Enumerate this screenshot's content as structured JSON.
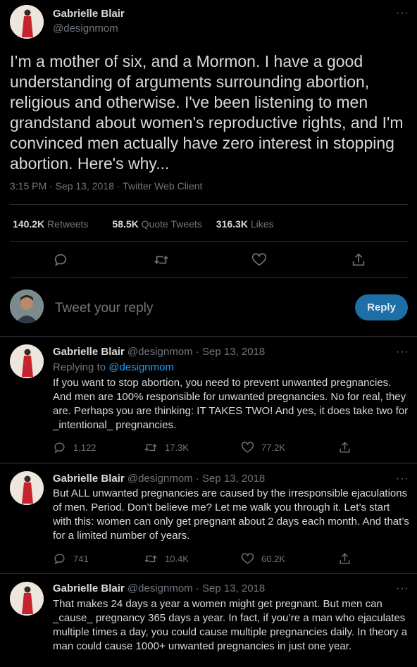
{
  "main": {
    "author_name": "Gabrielle Blair",
    "author_handle": "@designmom",
    "more": "···",
    "text": "I’m a mother of six, and a Mormon. I have a good understanding of arguments surrounding abortion, religious and otherwise. I've been listening to men grandstand about women's reproductive rights, and I'm convinced men actually have zero interest in stopping abortion. Here's why...",
    "meta": "3:15 PM · Sep 13, 2018 · Twitter Web Client",
    "retweets_count": "140.2K",
    "retweets_label": "Retweets",
    "quotes_count": "58.5K",
    "quotes_label": "Quote Tweets",
    "likes_count": "316.3K",
    "likes_label": "Likes"
  },
  "compose": {
    "placeholder": "Tweet your reply",
    "button": "Reply"
  },
  "replies": [
    {
      "name": "Gabrielle Blair",
      "handle_date": "@designmom · Sep 13, 2018",
      "replying_label": "Replying to",
      "replying_handle": "@designmom",
      "text": "If you want to stop abortion, you need to prevent unwanted pregnancies. And men are 100% responsible for unwanted pregnancies. No for real, they are. Perhaps you are thinking: IT TAKES TWO! And yes, it does take two for _intentional_ pregnancies.",
      "replies": "1,122",
      "retweets": "17.3K",
      "likes": "77.2K"
    },
    {
      "name": "Gabrielle Blair",
      "handle_date": "@designmom · Sep 13, 2018",
      "text": "But ALL unwanted pregnancies are caused by the irresponsible ejaculations of men. Period. Don’t believe me? Let me walk you through it. Let’s start with this: women can only get pregnant about 2 days each month. And that’s for a limited number of years.",
      "replies": "741",
      "retweets": "10.4K",
      "likes": "60.2K"
    },
    {
      "name": "Gabrielle Blair",
      "handle_date": "@designmom · Sep 13, 2018",
      "text": "That makes 24 days a year a women might get pregnant. But men can _cause_ pregnancy 365 days a year. In fact, if you’re a man who ejaculates multiple times a day, you could cause multiple pregnancies daily. In theory a man could cause 1000+ unwanted pregnancies in just one year."
    }
  ],
  "colors": {
    "background": "#000000",
    "accent": "#1d9bf0",
    "muted": "#6e767d",
    "text": "#d9d9d9"
  }
}
